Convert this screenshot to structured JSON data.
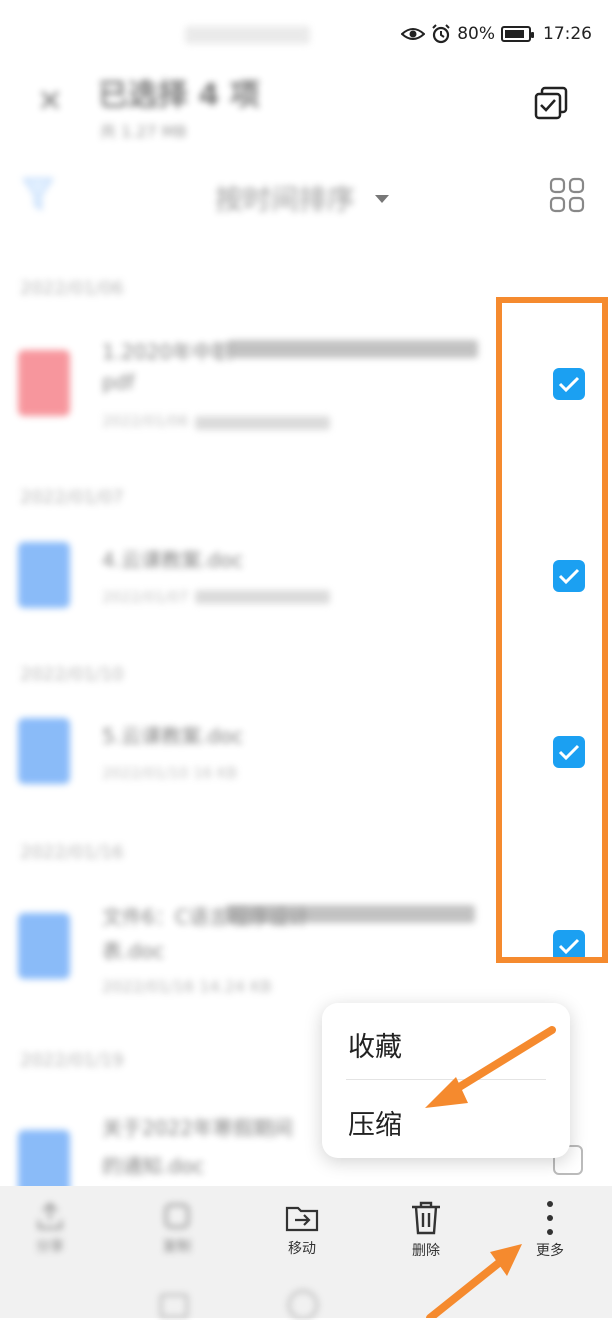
{
  "status_bar": {
    "battery": "80%",
    "time": "17:26"
  },
  "header": {
    "title": "已选择 4 项",
    "subtitle": "共 1.27 MB"
  },
  "toolbar": {
    "sort_label": "按时间排序"
  },
  "file_list": {
    "groups": [
      {
        "date": "2022/01/06",
        "name_line1": "1.2020年中职",
        "name_line2": "pdf",
        "meta": "2022/01/06",
        "checked": true
      },
      {
        "date": "2022/01/07",
        "name_line1": "4.云课教案.doc",
        "meta": "2022/01/07",
        "checked": true
      },
      {
        "date": "2022/01/10",
        "name_line1": "5.云课教案.doc",
        "meta": "2022/01/10  16 KB",
        "checked": true
      },
      {
        "date": "2022/01/16",
        "name_line1": "文件6：C语言程序设计",
        "name_line2": "表.doc",
        "meta": "2022/01/16  14.24 KB",
        "checked": true
      },
      {
        "date": "2022/01/19",
        "name_line1": "关于2022年寒假期间",
        "name_line2": "的通知.doc",
        "meta": "",
        "checked": false
      }
    ]
  },
  "popup_menu": {
    "items": [
      "收藏",
      "压缩"
    ]
  },
  "bottom_actions": [
    {
      "label": "分享",
      "icon": "share-icon"
    },
    {
      "label": "复制",
      "icon": "copy-icon"
    },
    {
      "label": "移动",
      "icon": "move-folder-icon"
    },
    {
      "label": "删除",
      "icon": "trash-icon"
    },
    {
      "label": "更多",
      "icon": "more-vertical-icon"
    }
  ],
  "colors": {
    "checkbox_blue": "#1ba0f2",
    "highlight_orange": "#f58a2e",
    "pdf_red": "#f2525d",
    "doc_blue": "#3d8ef5"
  }
}
